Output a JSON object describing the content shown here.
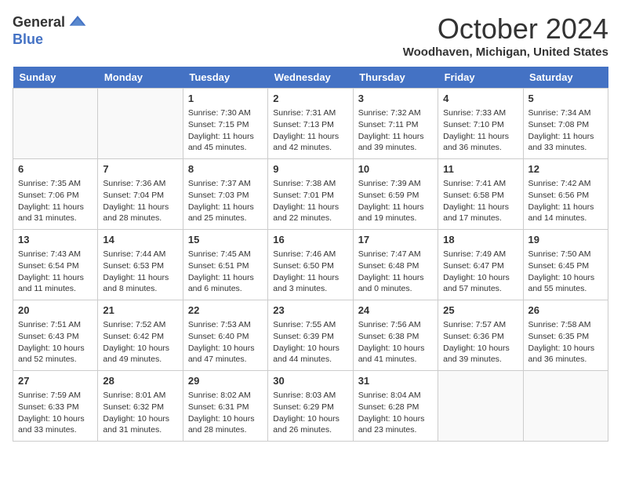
{
  "header": {
    "logo_general": "General",
    "logo_blue": "Blue",
    "month_title": "October 2024",
    "location": "Woodhaven, Michigan, United States"
  },
  "days_of_week": [
    "Sunday",
    "Monday",
    "Tuesday",
    "Wednesday",
    "Thursday",
    "Friday",
    "Saturday"
  ],
  "weeks": [
    [
      {
        "day": "",
        "info": ""
      },
      {
        "day": "",
        "info": ""
      },
      {
        "day": "1",
        "info": "Sunrise: 7:30 AM\nSunset: 7:15 PM\nDaylight: 11 hours and 45 minutes."
      },
      {
        "day": "2",
        "info": "Sunrise: 7:31 AM\nSunset: 7:13 PM\nDaylight: 11 hours and 42 minutes."
      },
      {
        "day": "3",
        "info": "Sunrise: 7:32 AM\nSunset: 7:11 PM\nDaylight: 11 hours and 39 minutes."
      },
      {
        "day": "4",
        "info": "Sunrise: 7:33 AM\nSunset: 7:10 PM\nDaylight: 11 hours and 36 minutes."
      },
      {
        "day": "5",
        "info": "Sunrise: 7:34 AM\nSunset: 7:08 PM\nDaylight: 11 hours and 33 minutes."
      }
    ],
    [
      {
        "day": "6",
        "info": "Sunrise: 7:35 AM\nSunset: 7:06 PM\nDaylight: 11 hours and 31 minutes."
      },
      {
        "day": "7",
        "info": "Sunrise: 7:36 AM\nSunset: 7:04 PM\nDaylight: 11 hours and 28 minutes."
      },
      {
        "day": "8",
        "info": "Sunrise: 7:37 AM\nSunset: 7:03 PM\nDaylight: 11 hours and 25 minutes."
      },
      {
        "day": "9",
        "info": "Sunrise: 7:38 AM\nSunset: 7:01 PM\nDaylight: 11 hours and 22 minutes."
      },
      {
        "day": "10",
        "info": "Sunrise: 7:39 AM\nSunset: 6:59 PM\nDaylight: 11 hours and 19 minutes."
      },
      {
        "day": "11",
        "info": "Sunrise: 7:41 AM\nSunset: 6:58 PM\nDaylight: 11 hours and 17 minutes."
      },
      {
        "day": "12",
        "info": "Sunrise: 7:42 AM\nSunset: 6:56 PM\nDaylight: 11 hours and 14 minutes."
      }
    ],
    [
      {
        "day": "13",
        "info": "Sunrise: 7:43 AM\nSunset: 6:54 PM\nDaylight: 11 hours and 11 minutes."
      },
      {
        "day": "14",
        "info": "Sunrise: 7:44 AM\nSunset: 6:53 PM\nDaylight: 11 hours and 8 minutes."
      },
      {
        "day": "15",
        "info": "Sunrise: 7:45 AM\nSunset: 6:51 PM\nDaylight: 11 hours and 6 minutes."
      },
      {
        "day": "16",
        "info": "Sunrise: 7:46 AM\nSunset: 6:50 PM\nDaylight: 11 hours and 3 minutes."
      },
      {
        "day": "17",
        "info": "Sunrise: 7:47 AM\nSunset: 6:48 PM\nDaylight: 11 hours and 0 minutes."
      },
      {
        "day": "18",
        "info": "Sunrise: 7:49 AM\nSunset: 6:47 PM\nDaylight: 10 hours and 57 minutes."
      },
      {
        "day": "19",
        "info": "Sunrise: 7:50 AM\nSunset: 6:45 PM\nDaylight: 10 hours and 55 minutes."
      }
    ],
    [
      {
        "day": "20",
        "info": "Sunrise: 7:51 AM\nSunset: 6:43 PM\nDaylight: 10 hours and 52 minutes."
      },
      {
        "day": "21",
        "info": "Sunrise: 7:52 AM\nSunset: 6:42 PM\nDaylight: 10 hours and 49 minutes."
      },
      {
        "day": "22",
        "info": "Sunrise: 7:53 AM\nSunset: 6:40 PM\nDaylight: 10 hours and 47 minutes."
      },
      {
        "day": "23",
        "info": "Sunrise: 7:55 AM\nSunset: 6:39 PM\nDaylight: 10 hours and 44 minutes."
      },
      {
        "day": "24",
        "info": "Sunrise: 7:56 AM\nSunset: 6:38 PM\nDaylight: 10 hours and 41 minutes."
      },
      {
        "day": "25",
        "info": "Sunrise: 7:57 AM\nSunset: 6:36 PM\nDaylight: 10 hours and 39 minutes."
      },
      {
        "day": "26",
        "info": "Sunrise: 7:58 AM\nSunset: 6:35 PM\nDaylight: 10 hours and 36 minutes."
      }
    ],
    [
      {
        "day": "27",
        "info": "Sunrise: 7:59 AM\nSunset: 6:33 PM\nDaylight: 10 hours and 33 minutes."
      },
      {
        "day": "28",
        "info": "Sunrise: 8:01 AM\nSunset: 6:32 PM\nDaylight: 10 hours and 31 minutes."
      },
      {
        "day": "29",
        "info": "Sunrise: 8:02 AM\nSunset: 6:31 PM\nDaylight: 10 hours and 28 minutes."
      },
      {
        "day": "30",
        "info": "Sunrise: 8:03 AM\nSunset: 6:29 PM\nDaylight: 10 hours and 26 minutes."
      },
      {
        "day": "31",
        "info": "Sunrise: 8:04 AM\nSunset: 6:28 PM\nDaylight: 10 hours and 23 minutes."
      },
      {
        "day": "",
        "info": ""
      },
      {
        "day": "",
        "info": ""
      }
    ]
  ]
}
